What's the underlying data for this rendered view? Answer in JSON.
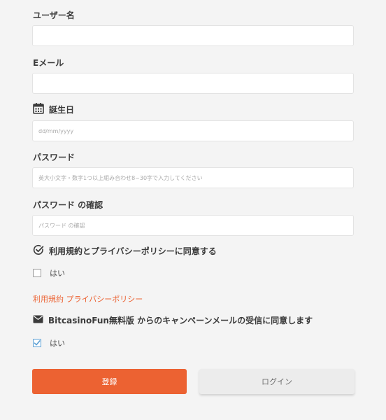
{
  "form": {
    "username": {
      "label": "ユーザー名",
      "value": "",
      "placeholder": ""
    },
    "email": {
      "label": "Eメール",
      "value": "",
      "placeholder": ""
    },
    "birthday": {
      "label": "誕生日",
      "value": "",
      "placeholder": "dd/mm/yyyy",
      "icon": "calendar-icon"
    },
    "password": {
      "label": "パスワード",
      "value": "",
      "placeholder": "英大小文字・数字1つ以上組み合わせ8~30字で入力してください"
    },
    "password_confirm": {
      "label": "パスワード の確認",
      "value": "",
      "placeholder": "パスワード の確認"
    },
    "terms": {
      "label": "利用規約とプライバシーポリシーに同意する",
      "icon": "check-circle-icon",
      "checkbox_label": "はい",
      "checked": false
    },
    "links": {
      "terms": "利用規約",
      "privacy": "プライバシーポリシー"
    },
    "marketing": {
      "label": "BitcasinoFun無料版 からのキャンペーンメールの受信に同意します",
      "icon": "envelope-icon",
      "checkbox_label": "はい",
      "checked": true
    }
  },
  "buttons": {
    "register": "登録",
    "login": "ログイン"
  },
  "colors": {
    "accent": "#ec6232",
    "check": "#5a9fd4",
    "background": "#f4f4f4"
  }
}
